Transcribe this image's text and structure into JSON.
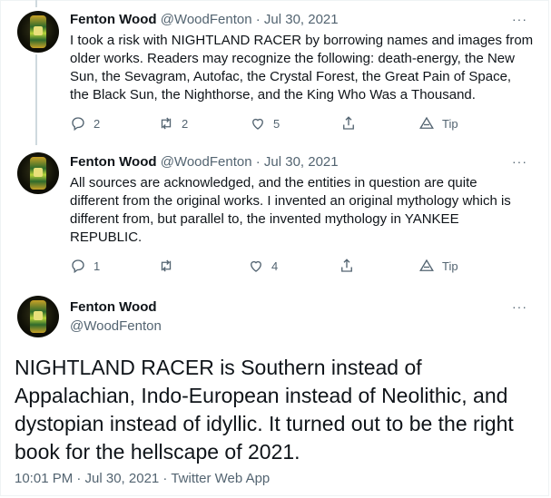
{
  "tweets": [
    {
      "name": "Fenton Wood",
      "handle": "@WoodFenton",
      "sep": "·",
      "date": "Jul 30, 2021",
      "more": "···",
      "lines": [
        "I took a risk with NIGHTLAND RACER by borrowing names and images from",
        "older works. Readers may recognize the following: death-energy, the New",
        "Sun, the Sevagram, Autofac, the Crystal Forest, the Great Pain of Space,",
        "the Black Sun, the Nighthorse, and the King Who Was a Thousand."
      ],
      "replies": "2",
      "retweets": "2",
      "likes": "5",
      "tip": "Tip"
    },
    {
      "name": "Fenton Wood",
      "handle": "@WoodFenton",
      "sep": "·",
      "date": "Jul 30, 2021",
      "more": "···",
      "lines": [
        "All sources are acknowledged, and the entities in question are quite",
        "different from the original works. I invented an original mythology which is",
        "different from, but parallel to, the invented mythology in YANKEE",
        "REPUBLIC."
      ],
      "replies": "1",
      "retweets": "",
      "likes": "4",
      "tip": "Tip"
    }
  ],
  "main": {
    "name": "Fenton Wood",
    "handle": "@WoodFenton",
    "more": "···",
    "lines": [
      "NIGHTLAND RACER is Southern instead of",
      "Appalachian, Indo-European instead of Neolithic, and",
      "dystopian instead of idyllic. It turned out to be the right",
      "book for the hellscape of 2021."
    ],
    "meta": "10:01 PM · Jul 30, 2021 · Twitter Web App"
  },
  "colors": {
    "text": "#0f1419",
    "muted": "#536471",
    "thread": "#cfd9de",
    "border": "#eff3f4"
  },
  "icons": [
    "reply-icon",
    "retweet-icon",
    "like-icon",
    "share-icon",
    "tip-icon",
    "more-icon"
  ]
}
